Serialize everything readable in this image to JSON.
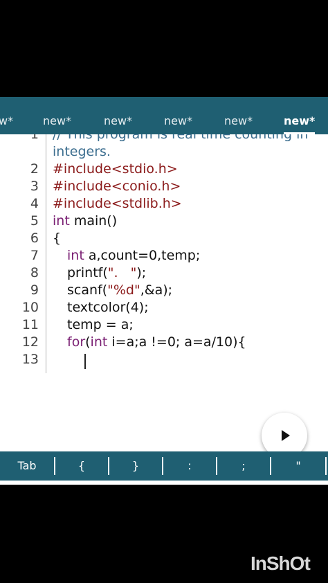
{
  "tabs": [
    {
      "label": "w*"
    },
    {
      "label": "new*"
    },
    {
      "label": "new*"
    },
    {
      "label": "new*"
    },
    {
      "label": "new*"
    },
    {
      "label": "new*",
      "active": true
    }
  ],
  "editor": {
    "lines": [
      {
        "num": "1",
        "text": "// This program is real time counting in"
      },
      {
        "num": "",
        "text": "integers."
      },
      {
        "num": "2",
        "text": "#include<stdio.h>"
      },
      {
        "num": "3",
        "text": "#include<conio.h>"
      },
      {
        "num": "4",
        "text": "#include<stdlib.h>"
      },
      {
        "num": "5",
        "kw": "int",
        "rest": " main()"
      },
      {
        "num": "6",
        "text": "{"
      },
      {
        "num": "7",
        "kw": "int",
        "rest": " a,count=0,temp;"
      },
      {
        "num": "8",
        "pre": "printf(",
        "str": "\".   \"",
        "post": ");"
      },
      {
        "num": "9",
        "pre": "scanf(",
        "str": "\"%d\"",
        "post": ",&a);"
      },
      {
        "num": "10",
        "text": "textcolor(4);"
      },
      {
        "num": "11",
        "text": "temp = a;"
      },
      {
        "num": "12",
        "kw": "for",
        "kw2": "int",
        "rest": " i=a;a !=0; a=a/10){"
      },
      {
        "num": "13",
        "text": ""
      }
    ]
  },
  "keys": [
    "Tab",
    "{",
    "}",
    ":",
    ";",
    "\""
  ],
  "watermark": "InShOt",
  "colors": {
    "bar": "#1f5f72",
    "keyword": "#7a1f73",
    "preprocessor": "#8b1a1a"
  }
}
